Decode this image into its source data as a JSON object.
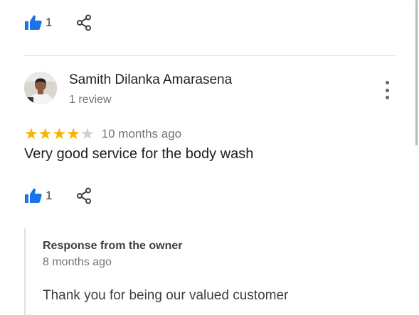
{
  "previous_review": {
    "likes": "1"
  },
  "review": {
    "reviewer_name": "Samith Dilanka Amarasena",
    "review_count": "1 review",
    "rating": 4,
    "rating_max": 5,
    "date": "10 months ago",
    "text": "Very good service for the body wash",
    "likes": "1"
  },
  "owner_response": {
    "title": "Response from the owner",
    "date": "8 months ago",
    "text": "Thank you for being our valued customer"
  },
  "icons": {
    "like": "thumbs-up-icon",
    "share": "share-icon",
    "more": "more-vert-icon"
  },
  "colors": {
    "like_blue": "#1a73e8",
    "star_gold": "#f5b400",
    "star_empty": "#d0d0d0",
    "secondary_text": "#70757a"
  }
}
